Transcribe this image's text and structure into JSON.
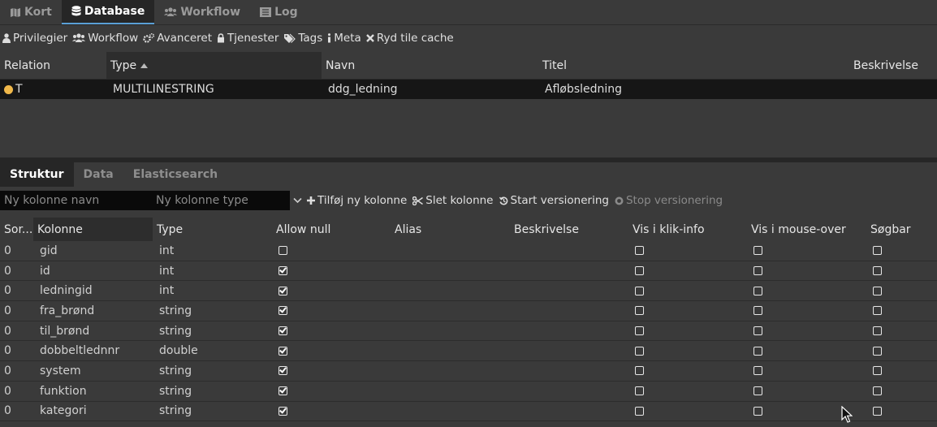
{
  "nav": {
    "tabs": [
      {
        "label": "Kort",
        "icon": "map-icon"
      },
      {
        "label": "Database",
        "icon": "database-icon",
        "active": true
      },
      {
        "label": "Workflow",
        "icon": "users-icon"
      },
      {
        "label": "Log",
        "icon": "list-icon"
      }
    ]
  },
  "toolbar": {
    "items": [
      {
        "label": "Privilegier",
        "icon": "user-icon"
      },
      {
        "label": "Workflow",
        "icon": "users-icon"
      },
      {
        "label": "Avanceret",
        "icon": "gears-icon"
      },
      {
        "label": "Tjenester",
        "icon": "lock-icon"
      },
      {
        "label": "Tags",
        "icon": "tags-icon"
      },
      {
        "label": "Meta",
        "icon": "info-icon"
      },
      {
        "label": "Ryd tile cache",
        "icon": "times-icon"
      }
    ]
  },
  "relation_table": {
    "headers": {
      "relation": "Relation",
      "type": "Type",
      "navn": "Navn",
      "titel": "Titel",
      "beskrivelse": "Beskrivelse"
    },
    "rows": [
      {
        "relation": "T",
        "type": "MULTILINESTRING",
        "navn": "ddg_ledning",
        "titel": "Afløbsledning",
        "beskrivelse": ""
      }
    ]
  },
  "subtabs": [
    {
      "label": "Struktur",
      "active": true
    },
    {
      "label": "Data"
    },
    {
      "label": "Elasticsearch"
    }
  ],
  "column_tools": {
    "name_placeholder": "Ny kolonne navn",
    "type_placeholder": "Ny kolonne type",
    "add_label": "Tilføj ny kolonne",
    "delete_label": "Slet kolonne",
    "start_version_label": "Start versionering",
    "stop_version_label": "Stop versionering"
  },
  "column_table": {
    "headers": {
      "sort": "Sor...",
      "kolonne": "Kolonne",
      "type": "Type",
      "allow_null": "Allow null",
      "alias": "Alias",
      "beskrivelse": "Beskrivelse",
      "klik": "Vis i klik-info",
      "mouse": "Vis i mouse-over",
      "soegbar": "Søgbar"
    },
    "rows": [
      {
        "sort": "0",
        "kolonne": "gid",
        "type": "int",
        "allow_null": false,
        "klik": false,
        "mouse": false,
        "soegbar": false
      },
      {
        "sort": "0",
        "kolonne": "id",
        "type": "int",
        "allow_null": true,
        "klik": false,
        "mouse": false,
        "soegbar": false
      },
      {
        "sort": "0",
        "kolonne": "ledningid",
        "type": "int",
        "allow_null": true,
        "klik": false,
        "mouse": false,
        "soegbar": false
      },
      {
        "sort": "0",
        "kolonne": "fra_brønd",
        "type": "string",
        "allow_null": true,
        "klik": false,
        "mouse": false,
        "soegbar": false
      },
      {
        "sort": "0",
        "kolonne": "til_brønd",
        "type": "string",
        "allow_null": true,
        "klik": false,
        "mouse": false,
        "soegbar": false
      },
      {
        "sort": "0",
        "kolonne": "dobbeltlednnr",
        "type": "double",
        "allow_null": true,
        "klik": false,
        "mouse": false,
        "soegbar": false
      },
      {
        "sort": "0",
        "kolonne": "system",
        "type": "string",
        "allow_null": true,
        "klik": false,
        "mouse": false,
        "soegbar": false
      },
      {
        "sort": "0",
        "kolonne": "funktion",
        "type": "string",
        "allow_null": true,
        "klik": false,
        "mouse": false,
        "soegbar": false
      },
      {
        "sort": "0",
        "kolonne": "kategori",
        "type": "string",
        "allow_null": true,
        "klik": false,
        "mouse": false,
        "soegbar": false
      }
    ]
  },
  "colors": {
    "accent": "#5a9fd6",
    "status_dot": "#f0b84a"
  }
}
